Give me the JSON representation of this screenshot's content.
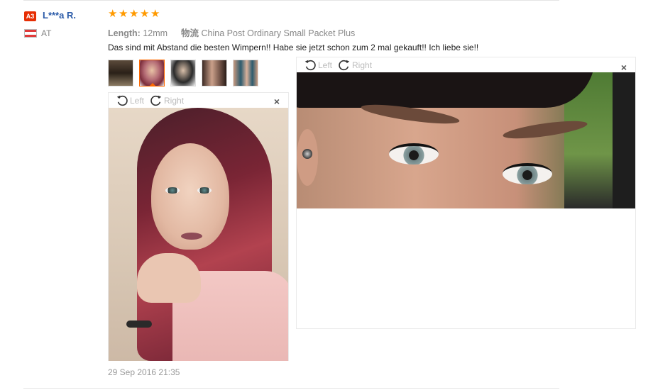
{
  "user": {
    "level_badge": "A3",
    "name": "L***a R.",
    "country_code": "AT",
    "flag_colors": [
      "#e03a3a",
      "#ffffff",
      "#e03a3a"
    ]
  },
  "review": {
    "stars": 5,
    "star_glyph": "★",
    "attributes": [
      {
        "key": "Length:",
        "value": "12mm"
      },
      {
        "key": "物流",
        "value": "China Post Ordinary Small Packet Plus"
      }
    ],
    "text": "Das sind mit Abstand die besten Wimpern!! Habe sie jetzt schon zum 2 mal gekauft!! Ich liebe sie!!",
    "date": "29 Sep 2016 21:35"
  },
  "gallery": {
    "thumbnails": [
      "photo-1",
      "photo-2",
      "photo-3",
      "photo-4",
      "photo-5"
    ],
    "active_index": 1
  },
  "viewer_left": {
    "rotate_left_label": "Left",
    "rotate_right_label": "Right",
    "close_glyph": "×"
  },
  "viewer_right": {
    "rotate_left_label": "Left",
    "rotate_right_label": "Right",
    "close_glyph": "×"
  },
  "colors": {
    "accent": "#ff6a00",
    "stars": "#ff9a00",
    "username": "#2a5aa8",
    "badge": "#e62e04"
  }
}
